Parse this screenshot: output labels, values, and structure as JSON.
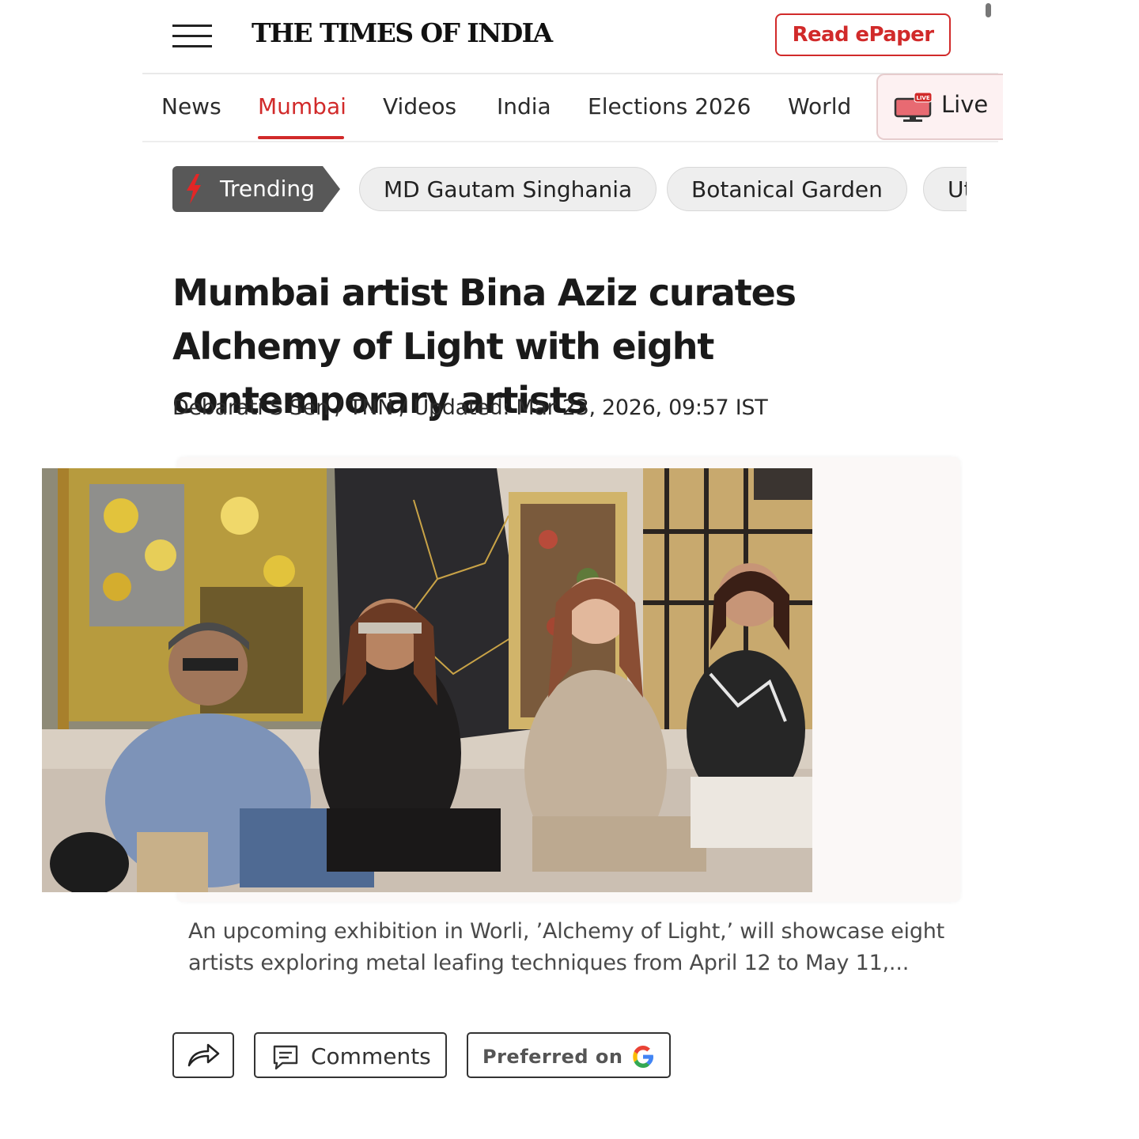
{
  "header": {
    "logo": "THE TIMES OF INDIA",
    "epaper_label": "Read ePaper"
  },
  "nav": {
    "items": [
      "News",
      "Mumbai",
      "Videos",
      "India",
      "Elections 2026",
      "World"
    ],
    "active": "Mumbai",
    "live_label": "Live",
    "live_badge": "LIVE"
  },
  "trending": {
    "label": "Trending",
    "chips": [
      "MD Gautam Singhania",
      "Botanical Garden",
      "Ut"
    ]
  },
  "article": {
    "headline": "Mumbai artist Bina Aziz curates Alchemy of Light with eight contemporary artists",
    "byline": "Debarati S Sen / TNN / Updated: Mar 23, 2026, 09:57 IST",
    "caption": "An upcoming exhibition in Worli, ’Alchemy of Light,’ will showcase eight artists exploring metal leafing techniques from April 12 to May 11,..."
  },
  "actions": {
    "comments_label": "Comments",
    "preferred_label": "Preferred on"
  },
  "colors": {
    "brand_red": "#d12a2a",
    "trending_bg": "#585858",
    "chip_bg": "#eeeeee"
  }
}
